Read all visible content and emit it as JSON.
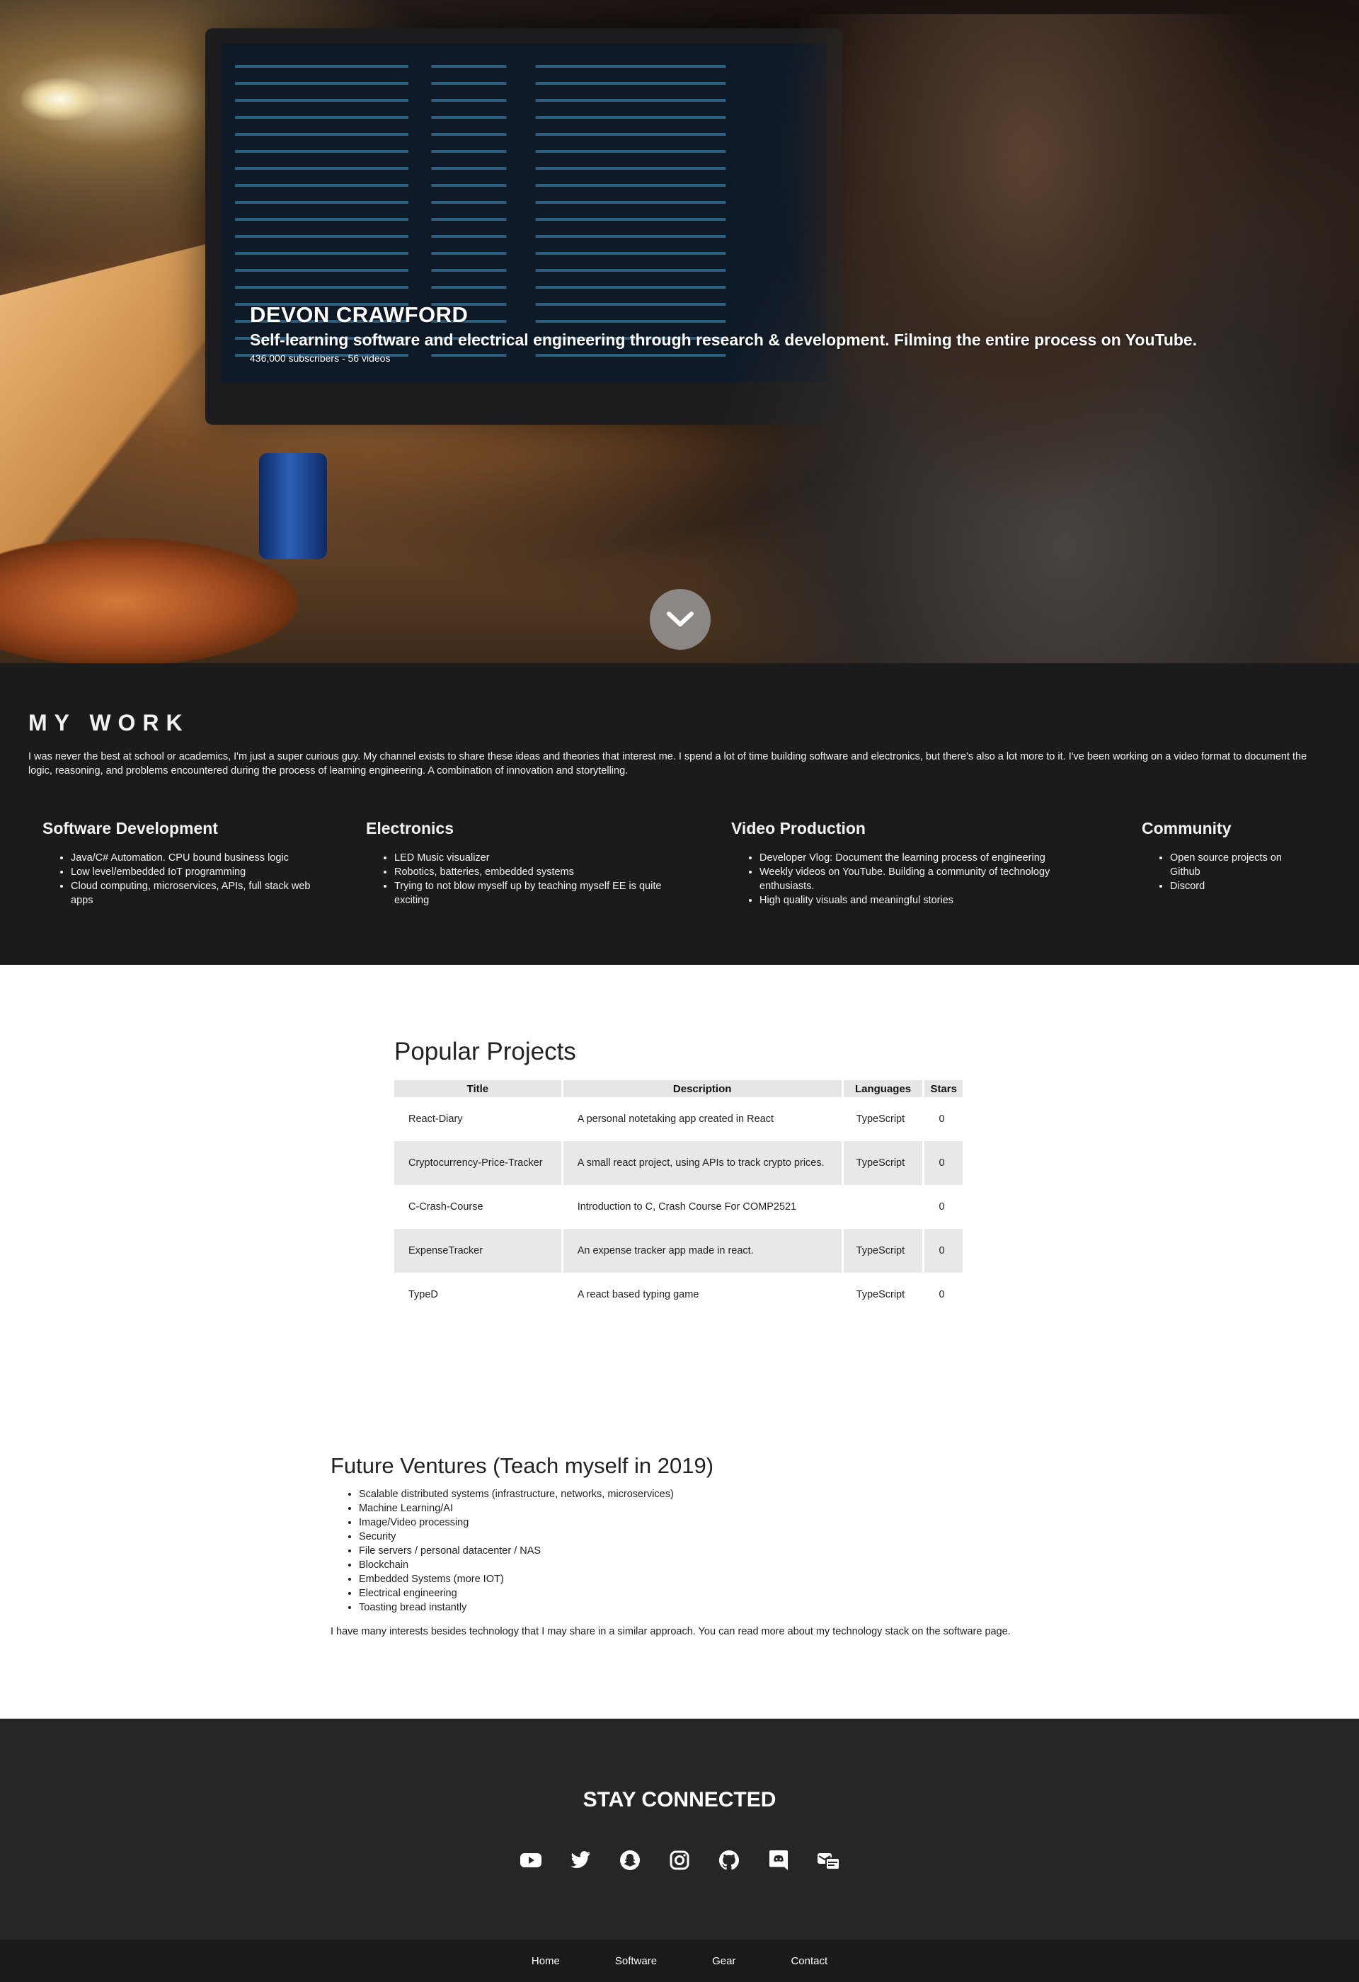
{
  "hero": {
    "name": "DEVON CRAWFORD",
    "tagline": "Self-learning software and electrical engineering through research & development. Filming the entire process on YouTube.",
    "meta": "436,000 subscribers - 56 videos",
    "scroll_icon": "chevron-down-icon"
  },
  "work": {
    "title": "MY WORK",
    "intro": "I was never the best at school or academics, I'm just a super curious guy. My channel exists to share these ideas and theories that interest me. I spend a lot of time building software and electronics, but there's also a lot more to it. I've been working on a video format to document the logic, reasoning, and problems encountered during the process of learning engineering. A combination of innovation and storytelling.",
    "columns": [
      {
        "title": "Software Development",
        "items": [
          "Java/C# Automation. CPU bound business logic",
          "Low level/embedded IoT programming",
          "Cloud computing, microservices, APIs, full stack web apps"
        ]
      },
      {
        "title": "Electronics",
        "items": [
          "LED Music visualizer",
          "Robotics, batteries, embedded systems",
          "Trying to not blow myself up by teaching myself EE is quite exciting"
        ]
      },
      {
        "title": "Video Production",
        "items": [
          "Developer Vlog: Document the learning process of engineering",
          "Weekly videos on YouTube. Building a community of technology enthusiasts.",
          "High quality visuals and meaningful stories"
        ]
      },
      {
        "title": "Community",
        "items": [
          "Open source projects on Github",
          "Discord"
        ]
      }
    ]
  },
  "projects": {
    "title": "Popular Projects",
    "headers": [
      "Title",
      "Description",
      "Languages",
      "Stars"
    ],
    "rows": [
      {
        "title": "React-Diary",
        "description": "A personal notetaking app created in React",
        "language": "TypeScript",
        "stars": "0"
      },
      {
        "title": "Cryptocurrency-Price-Tracker",
        "description": "A small react project, using APIs to track crypto prices.",
        "language": "TypeScript",
        "stars": "0"
      },
      {
        "title": "C-Crash-Course",
        "description": "Introduction to C, Crash Course For COMP2521",
        "language": "",
        "stars": "0"
      },
      {
        "title": "ExpenseTracker",
        "description": "An expense tracker app made in react.",
        "language": "TypeScript",
        "stars": "0"
      },
      {
        "title": "TypeD",
        "description": "A react based typing game",
        "language": "TypeScript",
        "stars": "0"
      }
    ]
  },
  "future": {
    "title": "Future Ventures (Teach myself in 2019)",
    "items": [
      "Scalable distributed systems (infrastructure, networks, microservices)",
      "Machine Learning/AI",
      "Image/Video processing",
      "Security",
      "File servers / personal datacenter / NAS",
      "Blockchain",
      "Embedded Systems (more IOT)",
      "Electrical engineering",
      "Toasting bread instantly"
    ],
    "note": "I have many interests besides technology that I may share in a similar approach. You can read more about my technology stack on the software page."
  },
  "connect": {
    "title": "STAY CONNECTED",
    "icons": [
      "youtube-icon",
      "twitter-icon",
      "snapchat-icon",
      "instagram-icon",
      "github-icon",
      "discord-icon",
      "mail-icon"
    ]
  },
  "footer": {
    "links": [
      "Home",
      "Software",
      "Gear",
      "Contact"
    ]
  },
  "colors": {
    "work_bg": "#1b1b1b",
    "connect_bg": "#262626",
    "footer_bg": "#1a1a1a",
    "table_alt": "#e8e8e8"
  }
}
